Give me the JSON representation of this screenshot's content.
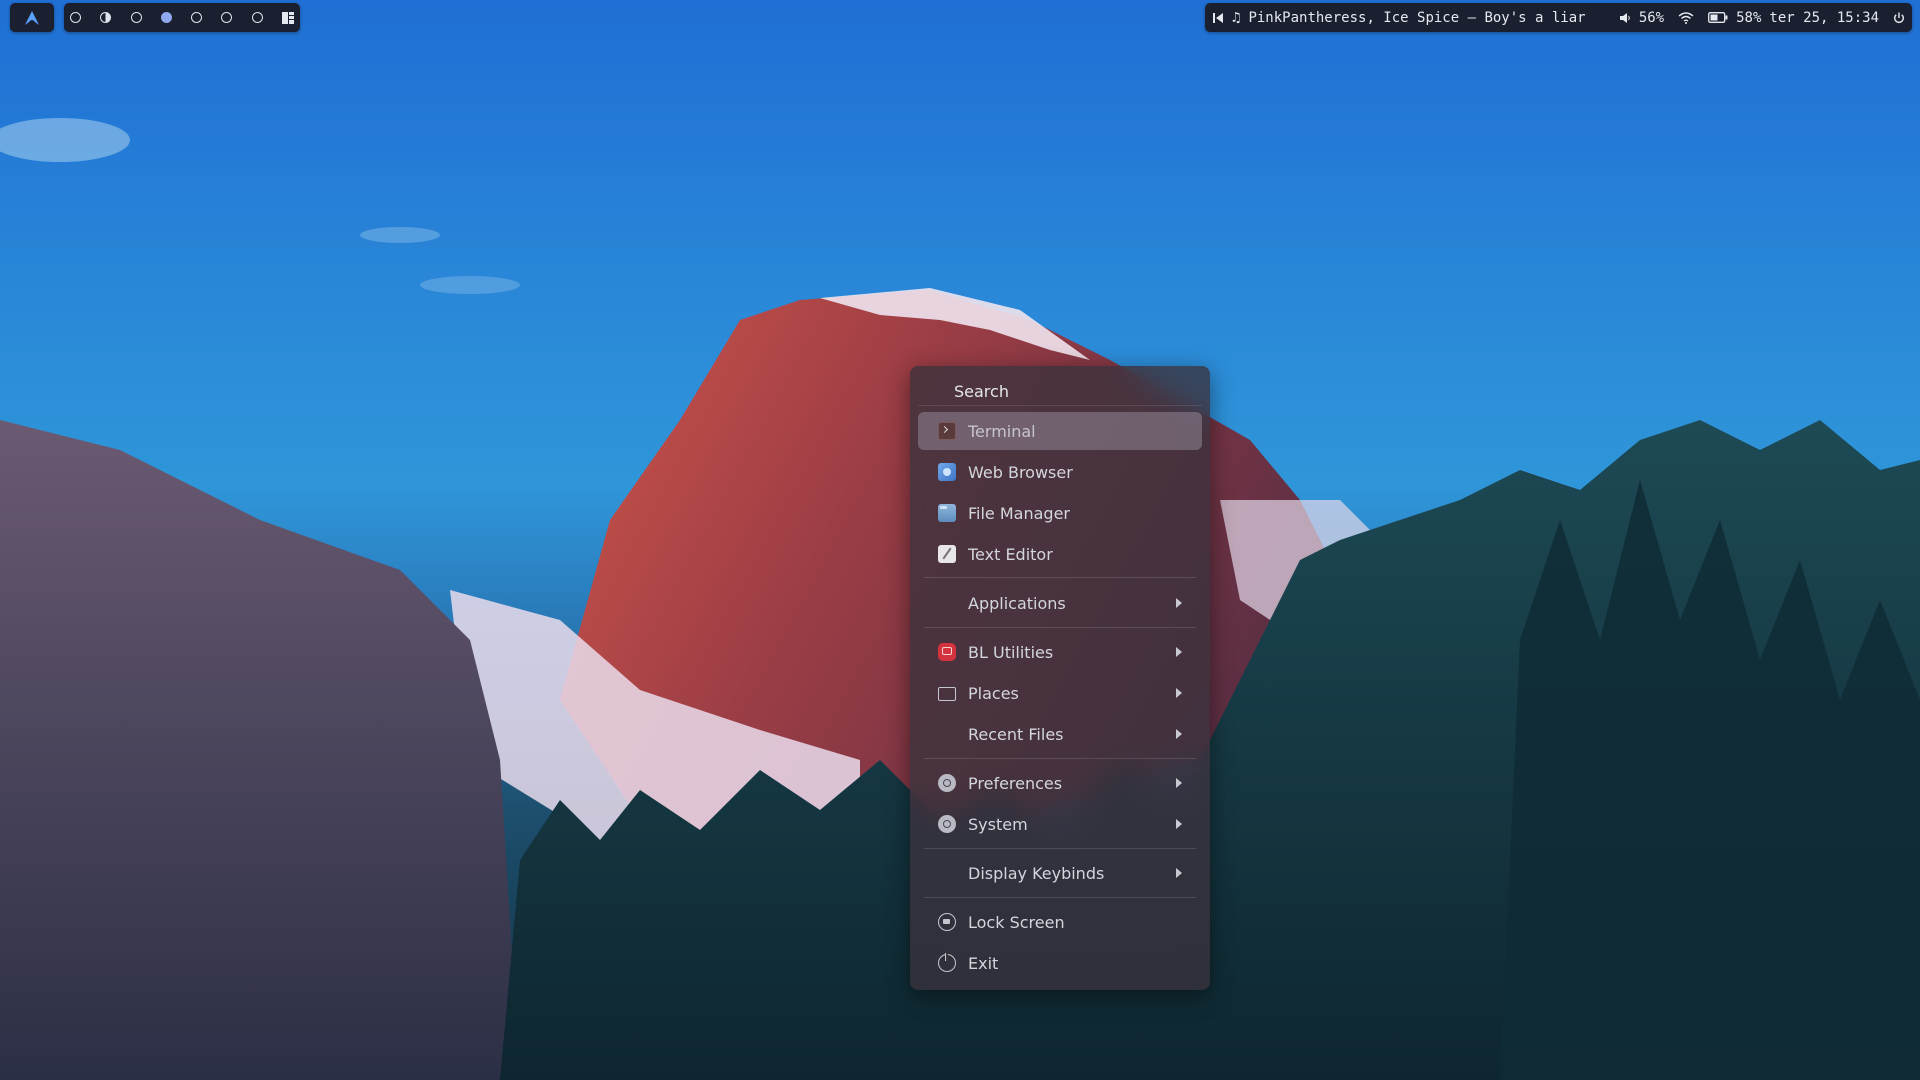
{
  "topbar": {
    "workspaces": [
      {
        "state": "empty"
      },
      {
        "state": "half"
      },
      {
        "state": "empty"
      },
      {
        "state": "active"
      },
      {
        "state": "empty"
      },
      {
        "state": "empty"
      },
      {
        "state": "empty"
      }
    ],
    "status": {
      "song": "PinkPantheress, Ice Spice – Boy's a liar",
      "volume": "56%",
      "battery": "58%",
      "datetime": "ter 25, 15:34"
    }
  },
  "menu": {
    "search_label": "Search",
    "items": [
      {
        "label": "Terminal",
        "icon": "terminal-icon"
      },
      {
        "label": "Web Browser",
        "icon": "web-browser-icon"
      },
      {
        "label": "File Manager",
        "icon": "file-manager-icon"
      },
      {
        "label": "Text Editor",
        "icon": "text-editor-icon"
      },
      {
        "label": "Applications"
      },
      {
        "label": "BL Utilities",
        "icon": "bl-utilities-icon"
      },
      {
        "label": "Places",
        "icon": "folder-icon"
      },
      {
        "label": "Recent Files"
      },
      {
        "label": "Preferences",
        "icon": "preferences-icon"
      },
      {
        "label": "System",
        "icon": "system-icon"
      },
      {
        "label": "Display Keybinds"
      },
      {
        "label": "Lock Screen",
        "icon": "lock-icon"
      },
      {
        "label": "Exit",
        "icon": "power-icon"
      }
    ]
  },
  "colors": {
    "bar_background": "#1b2030",
    "active_workspace": "#8fa8f0",
    "menu_background": "#3a323c",
    "bl_utilities_red": "#d2333f"
  }
}
